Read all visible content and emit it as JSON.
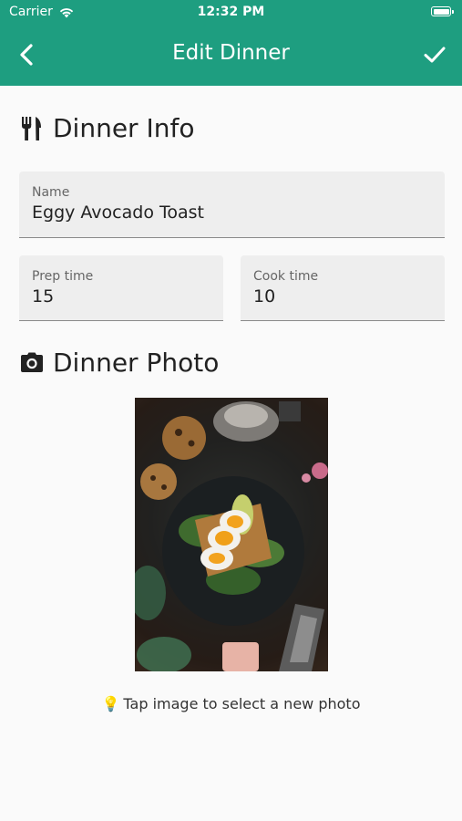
{
  "status_bar": {
    "carrier": "Carrier",
    "time": "12:32 PM"
  },
  "nav": {
    "title": "Edit Dinner",
    "back_icon": "chevron-left-icon",
    "save_icon": "checkmark-icon"
  },
  "colors": {
    "header": "#1e9e80",
    "background": "#fafafa",
    "field": "#eeeeee"
  },
  "dinner_info": {
    "title": "Dinner Info",
    "icon": "fork-knife-icon",
    "name": {
      "label": "Name",
      "value": "Eggy Avocado Toast"
    },
    "prep_time": {
      "label": "Prep time",
      "value": "15"
    },
    "cook_time": {
      "label": "Cook time",
      "value": "10"
    }
  },
  "dinner_photo": {
    "title": "Dinner Photo",
    "icon": "camera-icon",
    "hint": "Tap image to select a new photo",
    "hint_icon": "lightbulb-icon"
  }
}
